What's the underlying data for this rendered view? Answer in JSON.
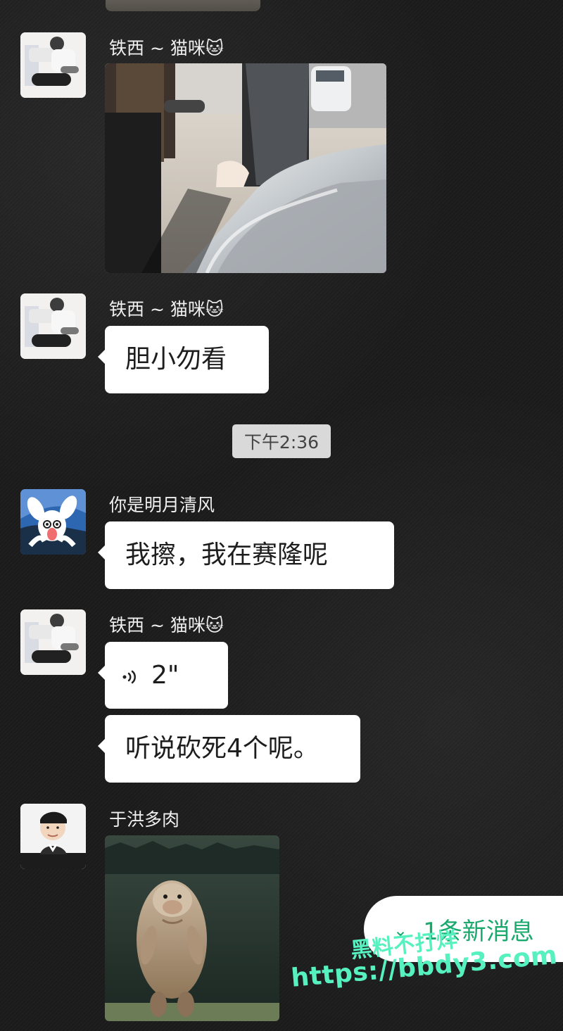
{
  "chat": {
    "messages": [
      {
        "sender": "铁西 ~ 猫咪🐱",
        "type": "image"
      },
      {
        "sender": "铁西 ~ 猫咪🐱",
        "type": "text",
        "text": "胆小勿看"
      },
      {
        "timestamp": "下午2:36"
      },
      {
        "sender": "你是明月清风",
        "type": "text",
        "text": "我擦，我在赛隆呢"
      },
      {
        "sender": "铁西 ~ 猫咪🐱",
        "type": "voice",
        "duration": "2\""
      },
      {
        "sender": "铁西 ~ 猫咪🐱",
        "type": "text",
        "text": "听说砍死4个呢。"
      },
      {
        "sender": "于洪多肉",
        "type": "image"
      }
    ],
    "new_messages_button": "1条新消息"
  },
  "watermark": {
    "line1": "黑料不打烊",
    "line2": "https://bbdy3.com"
  },
  "colors": {
    "background": "#1b1b1b",
    "bubble": "#ffffff",
    "accent": "#1aa96d",
    "watermark": "#56f1bf"
  },
  "icons": {
    "voice": "voice-wave-icon",
    "new_messages": "chevron-down-icon"
  }
}
